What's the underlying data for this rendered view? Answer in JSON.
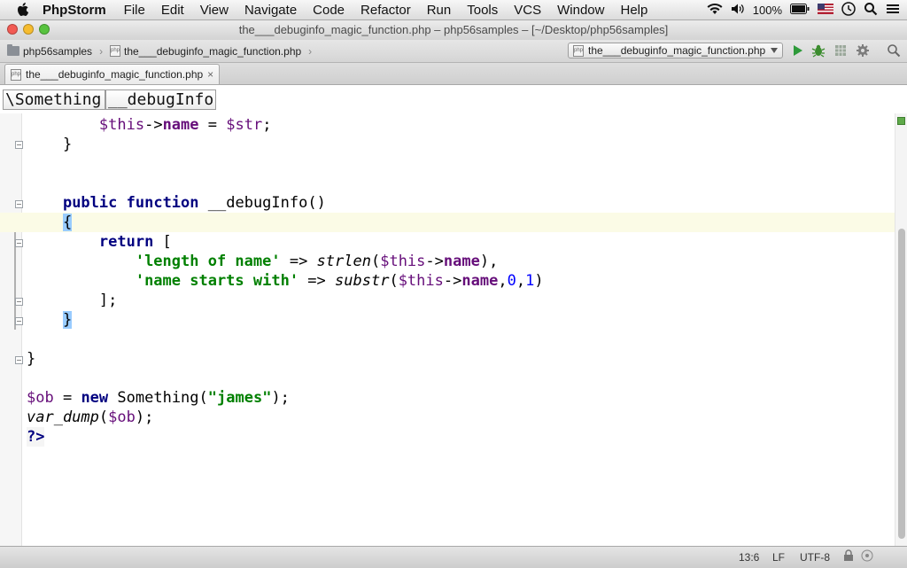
{
  "menubar": {
    "app_name": "PhpStorm",
    "items": [
      "File",
      "Edit",
      "View",
      "Navigate",
      "Code",
      "Refactor",
      "Run",
      "Tools",
      "VCS",
      "Window",
      "Help"
    ],
    "battery_percent": "100%",
    "icons": [
      "apple-icon",
      "wifi-icon",
      "volume-icon",
      "battery-icon",
      "flag-icon",
      "clock-icon",
      "spotlight-icon",
      "list-icon"
    ]
  },
  "window": {
    "title": "the___debuginfo_magic_function.php – php56samples – [~/Desktop/php56samples]"
  },
  "navbar": {
    "project": "php56samples",
    "file": "the___debuginfo_magic_function.php",
    "run_config": "the___debuginfo_magic_function.php"
  },
  "tabs": [
    {
      "label": "the___debuginfo_magic_function.php",
      "close": "×"
    }
  ],
  "structure": {
    "class": "\\Something",
    "method": "__debugInfo"
  },
  "code_lines": [
    "        $this->name = $str;",
    "    }",
    "",
    "    public function __debugInfo()",
    "    {",
    "        return [",
    "            'length of name' => strlen($this->name),",
    "            'name starts with' => substr($this->name,0,1)",
    "        ];",
    "    }",
    "",
    "}",
    "",
    "$ob = new Something(\"james\");",
    "var_dump($ob);",
    "?>"
  ],
  "current_line_index": 4,
  "status": {
    "position": "13:6",
    "line_sep": "LF",
    "encoding": "UTF-8"
  },
  "colors": {
    "keyword": "#000080",
    "variable": "#660e7a",
    "string": "#008000",
    "number": "#0000ff",
    "current_line": "#fbfbe6",
    "brace_highlight": "#99ccff"
  }
}
